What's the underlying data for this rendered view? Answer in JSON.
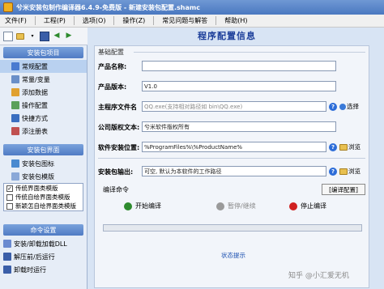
{
  "window": {
    "title": "兮米安装包制作编译器6.4.9-免费版 - 新建安装包配置.shamc"
  },
  "menu": [
    "文件(F)",
    "工程(P)",
    "选项(O)",
    "操作(Z)",
    "常见问题与解答",
    "帮助(H)"
  ],
  "toolbar": {
    "icons": [
      "new-icon",
      "open-icon",
      "save-icon",
      "back-icon",
      "forward-icon"
    ]
  },
  "sidebar": {
    "section1": "安装包项目",
    "items1": [
      "常规配置",
      "常量/变量",
      "添加数据",
      "操作配置",
      "快捷方式",
      "添注册表"
    ],
    "section2": "安装包界面",
    "items2": [
      "安装包图标",
      "安装包模版"
    ],
    "templates": [
      {
        "label": "传统界面类模版",
        "checked": true
      },
      {
        "label": "传统自绘界面类模版",
        "checked": false
      },
      {
        "label": "新颖怎自绘界面类模版",
        "checked": false
      }
    ],
    "section3": "命令设置",
    "items3": [
      "安装/卸载加载DLL",
      "解压前/后运行",
      "卸载时运行"
    ]
  },
  "main": {
    "title": "程序配置信息",
    "basic_section": "基础配置",
    "fields": {
      "product_name": {
        "label": "产品名称:",
        "value": ""
      },
      "product_version": {
        "label": "产品版本:",
        "value": "V1.0"
      },
      "main_program": {
        "label": "主程序文件名",
        "placeholder": "QQ.exe(支持相对路径如 bin\\QQ.exe)",
        "button": "选择"
      },
      "copyright": {
        "label": "公司版权文本:",
        "value": "兮米软件版权所有"
      },
      "install_location": {
        "label": "软件安装位置:",
        "value": "%ProgramFiles%\\%ProductName%",
        "button": "浏览"
      },
      "output": {
        "label": "安装包输出:",
        "value": "可空, 默认为本软件的工作路径",
        "button": "浏览"
      }
    },
    "compile": {
      "label": "编译命令",
      "config_button": "[编译配置]",
      "start": "开始编译",
      "pause": "暂停/继续",
      "stop": "停止编译",
      "progress": 0
    },
    "status_label": "状态提示"
  },
  "watermark": "知乎 @小汇爱无机",
  "colors": {
    "accent": "#1d3f9a",
    "start": "#2e8b2e",
    "stop": "#d02020",
    "help": "#2c6cd8"
  }
}
